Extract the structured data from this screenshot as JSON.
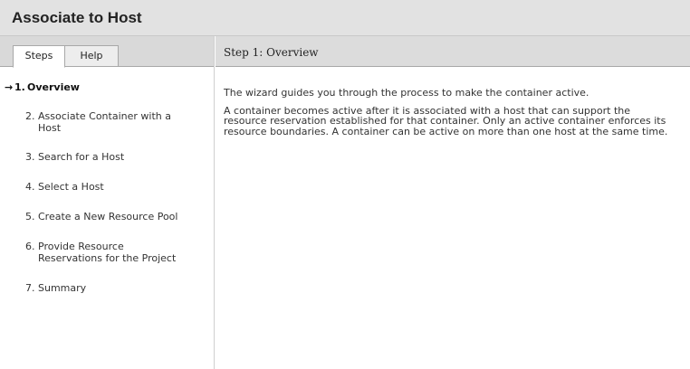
{
  "window": {
    "title": "Associate to Host"
  },
  "tabs": [
    {
      "label": "Steps",
      "active": true
    },
    {
      "label": "Help",
      "active": false
    }
  ],
  "steps": [
    {
      "number": "1.",
      "label": "Overview",
      "current": true
    },
    {
      "number": "2.",
      "label": "Associate Container with a Host"
    },
    {
      "number": "3.",
      "label": "Search for a Host"
    },
    {
      "number": "4.",
      "label": "Select a Host"
    },
    {
      "number": "5.",
      "label": "Create a New Resource Pool"
    },
    {
      "number": "6.",
      "label": "Provide Resource Reservations for the Project"
    },
    {
      "number": "7.",
      "label": "Summary"
    }
  ],
  "current_marker": "→",
  "main": {
    "step_title": "Step 1:  Overview",
    "paragraphs": [
      "The wizard guides you through the process to make the container active.",
      "A container becomes active after it is associated with a host that can support the resource reservation established for that container. Only an active container enforces its resource boundaries. A container can be active on more than one host at the same time."
    ]
  },
  "icons": {
    "current_step": "arrow-right-icon"
  }
}
